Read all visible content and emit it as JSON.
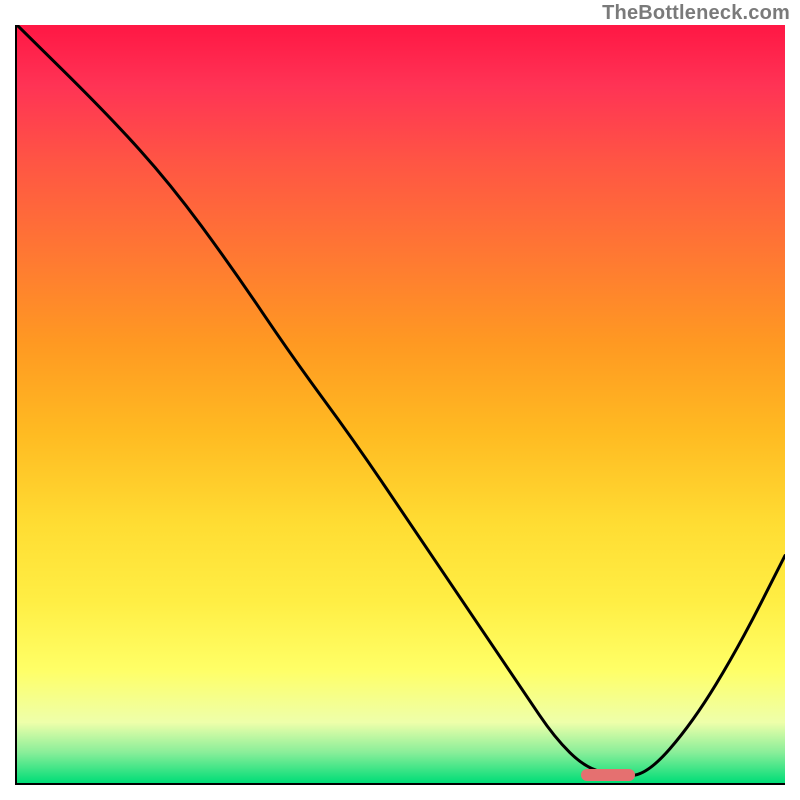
{
  "watermark": "TheBottleneck.com",
  "colors": {
    "curve": "#000000",
    "marker": "#e57070",
    "axis": "#000000"
  },
  "chart_data": {
    "type": "line",
    "title": "",
    "xlabel": "",
    "ylabel": "",
    "xlim": [
      0,
      100
    ],
    "ylim": [
      0,
      100
    ],
    "grid": false,
    "legend": false,
    "series": [
      {
        "name": "bottleneck-curve",
        "x": [
          0,
          12,
          20,
          28,
          36,
          44,
          52,
          60,
          66,
          70,
          74,
          78,
          82,
          88,
          94,
          100
        ],
        "values": [
          100,
          88,
          79,
          68,
          56,
          45,
          33,
          21,
          12,
          6,
          2,
          1,
          1,
          8,
          18,
          30
        ]
      }
    ],
    "marker": {
      "x": 77,
      "y": 1,
      "width": 7,
      "height": 1.6
    },
    "gradient_stops": [
      {
        "pct": 0,
        "color": "#ff1744"
      },
      {
        "pct": 8,
        "color": "#ff3355"
      },
      {
        "pct": 18,
        "color": "#ff5544"
      },
      {
        "pct": 30,
        "color": "#ff7733"
      },
      {
        "pct": 42,
        "color": "#ff9922"
      },
      {
        "pct": 54,
        "color": "#ffbb22"
      },
      {
        "pct": 66,
        "color": "#ffdd33"
      },
      {
        "pct": 76,
        "color": "#ffee44"
      },
      {
        "pct": 85,
        "color": "#ffff66"
      },
      {
        "pct": 92,
        "color": "#eeffaa"
      },
      {
        "pct": 96,
        "color": "#88ee99"
      },
      {
        "pct": 100,
        "color": "#00dd77"
      }
    ]
  }
}
